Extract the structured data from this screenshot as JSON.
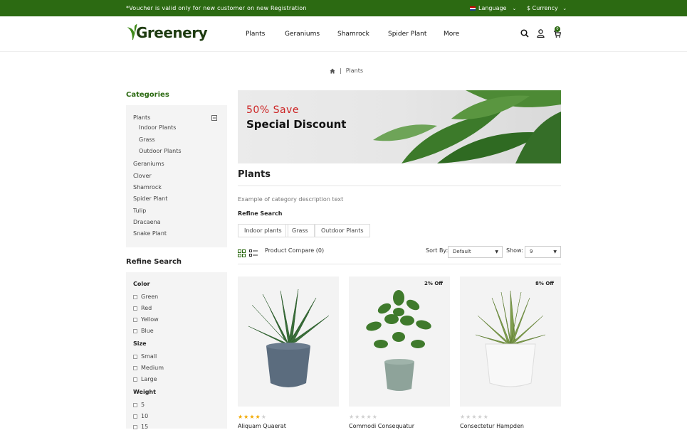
{
  "topbar": {
    "voucher": "*Voucher is valid only for new customer on new Registration",
    "language": "Language",
    "currency": "$ Currency"
  },
  "logo": "Greenery",
  "nav": [
    "Plants",
    "Geraniums",
    "Shamrock",
    "Spider Plant",
    "More"
  ],
  "cart_count": "0",
  "breadcrumb": {
    "current": "Plants"
  },
  "categories": {
    "title": "Categories",
    "items": [
      "Plants",
      "Indoor Plants",
      "Grass",
      "Outdoor Plants",
      "Geraniums",
      "Clover",
      "Shamrock",
      "Spider Plant",
      "Tulip",
      "Dracaena",
      "Snake Plant"
    ]
  },
  "refine": {
    "title": "Refine Search",
    "color_label": "Color",
    "colors": [
      "Green",
      "Red",
      "Yellow",
      "Blue"
    ],
    "size_label": "Size",
    "sizes": [
      "Small",
      "Medium",
      "Large"
    ],
    "weight_label": "Weight",
    "weights": [
      "5",
      "10",
      "15"
    ]
  },
  "banner": {
    "save": "50% Save",
    "discount": "Special Discount"
  },
  "main": {
    "title": "Plants",
    "description": "Example of category description text",
    "refine_title": "Refine Search",
    "chips": [
      "Indoor plants",
      "Grass",
      "Outdoor Plants"
    ],
    "compare": "Product Compare (0)",
    "sort_label": "Sort By:",
    "sort_value": "Default",
    "show_label": "Show:",
    "show_value": "9"
  },
  "products": [
    {
      "name": "Aliquam Quaerat",
      "off": "",
      "rating": 4
    },
    {
      "name": "Commodi Consequatur",
      "off": "2% Off",
      "rating": 0
    },
    {
      "name": "Consectetur Hampden",
      "off": "8% Off",
      "rating": 0
    }
  ],
  "colors": {
    "brand_green": "#2c6a12",
    "save_red": "#cc2222",
    "star_gold": "#f2a900"
  }
}
